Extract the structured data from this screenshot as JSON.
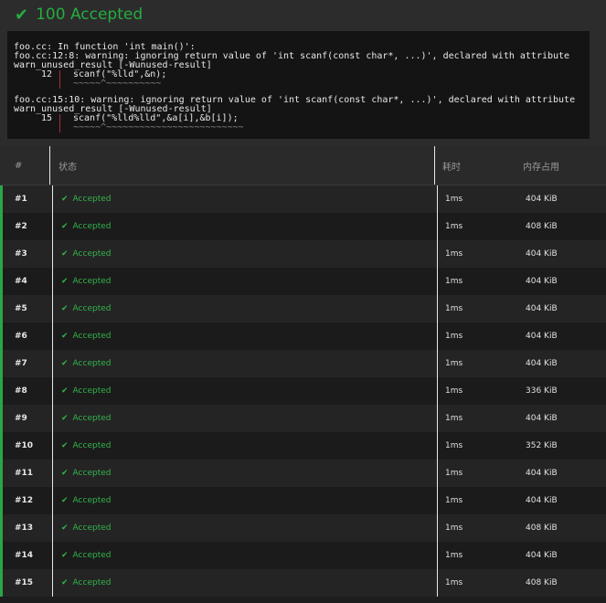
{
  "header": {
    "score": "100",
    "verdict": "Accepted",
    "icon": "check-icon",
    "color": "#25ad40"
  },
  "compiler": {
    "lines": [
      "foo.cc: In function 'int main()':",
      "foo.cc:12:8: warning: ignoring return value of 'int scanf(const char*, ...)', declared with attribute",
      "warn_unused_result [-Wunused-result]"
    ],
    "code1_lineno": "12",
    "code1_text": "scanf(\"%lld\",&n);",
    "code1_squiggle": "~~~~~^~~~~~~~~~~",
    "lines2": [
      "foo.cc:15:10: warning: ignoring return value of 'int scanf(const char*, ...)', declared with attribute",
      "warn_unused_result [-Wunused-result]"
    ],
    "code2_lineno": "15",
    "code2_text": "scanf(\"%lld%lld\",&a[i],&b[i]);",
    "code2_squiggle": "~~~~~^~~~~~~~~~~~~~~~~~~~~~~~~~"
  },
  "table": {
    "headers": {
      "num": "#",
      "status": "状态",
      "time": "耗时",
      "memory": "内存占用"
    },
    "rows": [
      {
        "num": "#1",
        "status": "Accepted",
        "time": "1ms",
        "memory": "404 KiB"
      },
      {
        "num": "#2",
        "status": "Accepted",
        "time": "1ms",
        "memory": "408 KiB"
      },
      {
        "num": "#3",
        "status": "Accepted",
        "time": "1ms",
        "memory": "404 KiB"
      },
      {
        "num": "#4",
        "status": "Accepted",
        "time": "1ms",
        "memory": "404 KiB"
      },
      {
        "num": "#5",
        "status": "Accepted",
        "time": "1ms",
        "memory": "404 KiB"
      },
      {
        "num": "#6",
        "status": "Accepted",
        "time": "1ms",
        "memory": "404 KiB"
      },
      {
        "num": "#7",
        "status": "Accepted",
        "time": "1ms",
        "memory": "404 KiB"
      },
      {
        "num": "#8",
        "status": "Accepted",
        "time": "1ms",
        "memory": "336 KiB"
      },
      {
        "num": "#9",
        "status": "Accepted",
        "time": "1ms",
        "memory": "404 KiB"
      },
      {
        "num": "#10",
        "status": "Accepted",
        "time": "1ms",
        "memory": "352 KiB"
      },
      {
        "num": "#11",
        "status": "Accepted",
        "time": "1ms",
        "memory": "404 KiB"
      },
      {
        "num": "#12",
        "status": "Accepted",
        "time": "1ms",
        "memory": "404 KiB"
      },
      {
        "num": "#13",
        "status": "Accepted",
        "time": "1ms",
        "memory": "408 KiB"
      },
      {
        "num": "#14",
        "status": "Accepted",
        "time": "1ms",
        "memory": "404 KiB"
      },
      {
        "num": "#15",
        "status": "Accepted",
        "time": "1ms",
        "memory": "408 KiB"
      }
    ]
  }
}
